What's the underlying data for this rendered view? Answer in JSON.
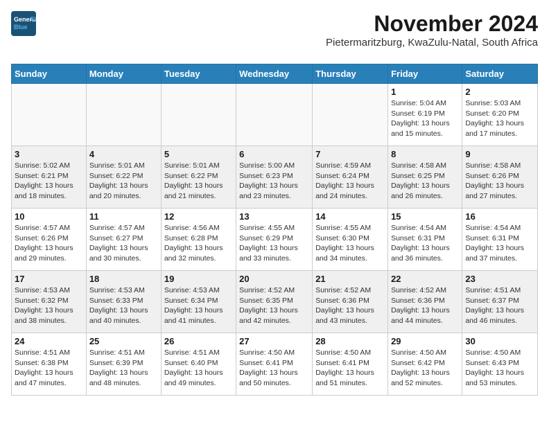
{
  "logo": {
    "line1": "General",
    "line2": "Blue"
  },
  "title": "November 2024",
  "subtitle": "Pietermaritzburg, KwaZulu-Natal, South Africa",
  "days_of_week": [
    "Sunday",
    "Monday",
    "Tuesday",
    "Wednesday",
    "Thursday",
    "Friday",
    "Saturday"
  ],
  "weeks": [
    {
      "cells": [
        {
          "day": "",
          "info": "",
          "empty": true
        },
        {
          "day": "",
          "info": "",
          "empty": true
        },
        {
          "day": "",
          "info": "",
          "empty": true
        },
        {
          "day": "",
          "info": "",
          "empty": true
        },
        {
          "day": "",
          "info": "",
          "empty": true
        },
        {
          "day": "1",
          "info": "Sunrise: 5:04 AM\nSunset: 6:19 PM\nDaylight: 13 hours\nand 15 minutes.",
          "empty": false
        },
        {
          "day": "2",
          "info": "Sunrise: 5:03 AM\nSunset: 6:20 PM\nDaylight: 13 hours\nand 17 minutes.",
          "empty": false
        }
      ]
    },
    {
      "cells": [
        {
          "day": "3",
          "info": "Sunrise: 5:02 AM\nSunset: 6:21 PM\nDaylight: 13 hours\nand 18 minutes.",
          "empty": false
        },
        {
          "day": "4",
          "info": "Sunrise: 5:01 AM\nSunset: 6:22 PM\nDaylight: 13 hours\nand 20 minutes.",
          "empty": false
        },
        {
          "day": "5",
          "info": "Sunrise: 5:01 AM\nSunset: 6:22 PM\nDaylight: 13 hours\nand 21 minutes.",
          "empty": false
        },
        {
          "day": "6",
          "info": "Sunrise: 5:00 AM\nSunset: 6:23 PM\nDaylight: 13 hours\nand 23 minutes.",
          "empty": false
        },
        {
          "day": "7",
          "info": "Sunrise: 4:59 AM\nSunset: 6:24 PM\nDaylight: 13 hours\nand 24 minutes.",
          "empty": false
        },
        {
          "day": "8",
          "info": "Sunrise: 4:58 AM\nSunset: 6:25 PM\nDaylight: 13 hours\nand 26 minutes.",
          "empty": false
        },
        {
          "day": "9",
          "info": "Sunrise: 4:58 AM\nSunset: 6:26 PM\nDaylight: 13 hours\nand 27 minutes.",
          "empty": false
        }
      ]
    },
    {
      "cells": [
        {
          "day": "10",
          "info": "Sunrise: 4:57 AM\nSunset: 6:26 PM\nDaylight: 13 hours\nand 29 minutes.",
          "empty": false
        },
        {
          "day": "11",
          "info": "Sunrise: 4:57 AM\nSunset: 6:27 PM\nDaylight: 13 hours\nand 30 minutes.",
          "empty": false
        },
        {
          "day": "12",
          "info": "Sunrise: 4:56 AM\nSunset: 6:28 PM\nDaylight: 13 hours\nand 32 minutes.",
          "empty": false
        },
        {
          "day": "13",
          "info": "Sunrise: 4:55 AM\nSunset: 6:29 PM\nDaylight: 13 hours\nand 33 minutes.",
          "empty": false
        },
        {
          "day": "14",
          "info": "Sunrise: 4:55 AM\nSunset: 6:30 PM\nDaylight: 13 hours\nand 34 minutes.",
          "empty": false
        },
        {
          "day": "15",
          "info": "Sunrise: 4:54 AM\nSunset: 6:31 PM\nDaylight: 13 hours\nand 36 minutes.",
          "empty": false
        },
        {
          "day": "16",
          "info": "Sunrise: 4:54 AM\nSunset: 6:31 PM\nDaylight: 13 hours\nand 37 minutes.",
          "empty": false
        }
      ]
    },
    {
      "cells": [
        {
          "day": "17",
          "info": "Sunrise: 4:53 AM\nSunset: 6:32 PM\nDaylight: 13 hours\nand 38 minutes.",
          "empty": false
        },
        {
          "day": "18",
          "info": "Sunrise: 4:53 AM\nSunset: 6:33 PM\nDaylight: 13 hours\nand 40 minutes.",
          "empty": false
        },
        {
          "day": "19",
          "info": "Sunrise: 4:53 AM\nSunset: 6:34 PM\nDaylight: 13 hours\nand 41 minutes.",
          "empty": false
        },
        {
          "day": "20",
          "info": "Sunrise: 4:52 AM\nSunset: 6:35 PM\nDaylight: 13 hours\nand 42 minutes.",
          "empty": false
        },
        {
          "day": "21",
          "info": "Sunrise: 4:52 AM\nSunset: 6:36 PM\nDaylight: 13 hours\nand 43 minutes.",
          "empty": false
        },
        {
          "day": "22",
          "info": "Sunrise: 4:52 AM\nSunset: 6:36 PM\nDaylight: 13 hours\nand 44 minutes.",
          "empty": false
        },
        {
          "day": "23",
          "info": "Sunrise: 4:51 AM\nSunset: 6:37 PM\nDaylight: 13 hours\nand 46 minutes.",
          "empty": false
        }
      ]
    },
    {
      "cells": [
        {
          "day": "24",
          "info": "Sunrise: 4:51 AM\nSunset: 6:38 PM\nDaylight: 13 hours\nand 47 minutes.",
          "empty": false
        },
        {
          "day": "25",
          "info": "Sunrise: 4:51 AM\nSunset: 6:39 PM\nDaylight: 13 hours\nand 48 minutes.",
          "empty": false
        },
        {
          "day": "26",
          "info": "Sunrise: 4:51 AM\nSunset: 6:40 PM\nDaylight: 13 hours\nand 49 minutes.",
          "empty": false
        },
        {
          "day": "27",
          "info": "Sunrise: 4:50 AM\nSunset: 6:41 PM\nDaylight: 13 hours\nand 50 minutes.",
          "empty": false
        },
        {
          "day": "28",
          "info": "Sunrise: 4:50 AM\nSunset: 6:41 PM\nDaylight: 13 hours\nand 51 minutes.",
          "empty": false
        },
        {
          "day": "29",
          "info": "Sunrise: 4:50 AM\nSunset: 6:42 PM\nDaylight: 13 hours\nand 52 minutes.",
          "empty": false
        },
        {
          "day": "30",
          "info": "Sunrise: 4:50 AM\nSunset: 6:43 PM\nDaylight: 13 hours\nand 53 minutes.",
          "empty": false
        }
      ]
    }
  ]
}
